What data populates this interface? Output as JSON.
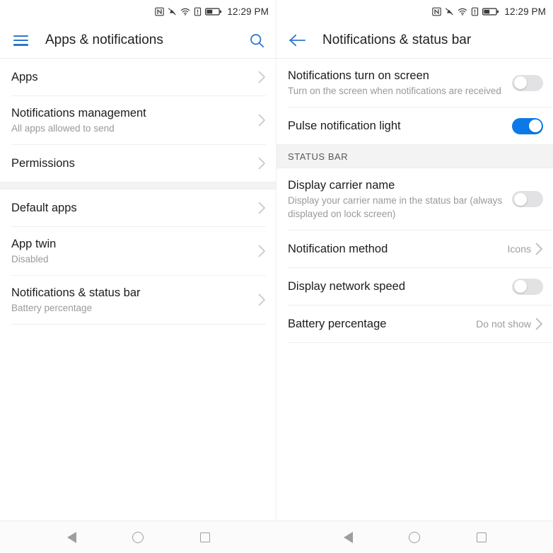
{
  "status_bar": {
    "time": "12:29 PM",
    "icons": [
      "nfc-icon",
      "mute-vibrate-icon",
      "wifi-icon",
      "sim-alert-icon",
      "battery-icon"
    ]
  },
  "left_panel": {
    "menu_icon": "hamburger-menu-icon",
    "title": "Apps & notifications",
    "search_icon": "search-icon",
    "groups": [
      {
        "items": [
          {
            "title": "Apps",
            "subtitle": "",
            "chevron": true
          },
          {
            "title": "Notifications management",
            "subtitle": "All apps allowed to send",
            "chevron": true
          },
          {
            "title": "Permissions",
            "subtitle": "",
            "chevron": true
          }
        ]
      },
      {
        "items": [
          {
            "title": "Default apps",
            "subtitle": "",
            "chevron": true
          },
          {
            "title": "App twin",
            "subtitle": "Disabled",
            "chevron": true
          },
          {
            "title": "Notifications & status bar",
            "subtitle": "Battery percentage",
            "chevron": true
          }
        ]
      }
    ]
  },
  "right_panel": {
    "back_icon": "back-arrow-icon",
    "title": "Notifications & status bar",
    "top_items": [
      {
        "title": "Notifications turn on screen",
        "subtitle": "Turn on the screen when notifications are received",
        "control": "toggle",
        "toggle_on": false
      },
      {
        "title": "Pulse notification light",
        "subtitle": "",
        "control": "toggle",
        "toggle_on": true
      }
    ],
    "section_header": "STATUS BAR",
    "section_items": [
      {
        "title": "Display carrier name",
        "subtitle": "Display your carrier name in the status bar (always displayed on lock screen)",
        "control": "toggle",
        "toggle_on": false,
        "value": ""
      },
      {
        "title": "Notification method",
        "subtitle": "",
        "control": "value",
        "value": "Icons"
      },
      {
        "title": "Display network speed",
        "subtitle": "",
        "control": "toggle",
        "toggle_on": false,
        "value": ""
      },
      {
        "title": "Battery percentage",
        "subtitle": "",
        "control": "value",
        "value": "Do not show"
      }
    ]
  },
  "nav_bar": {
    "back_label": "back-nav-button",
    "home_label": "home-nav-button",
    "recents_label": "recents-nav-button"
  },
  "colors": {
    "accent": "#2f77c9",
    "toggle_on": "#0b7ae8",
    "toggle_off": "#e2e2e4"
  }
}
